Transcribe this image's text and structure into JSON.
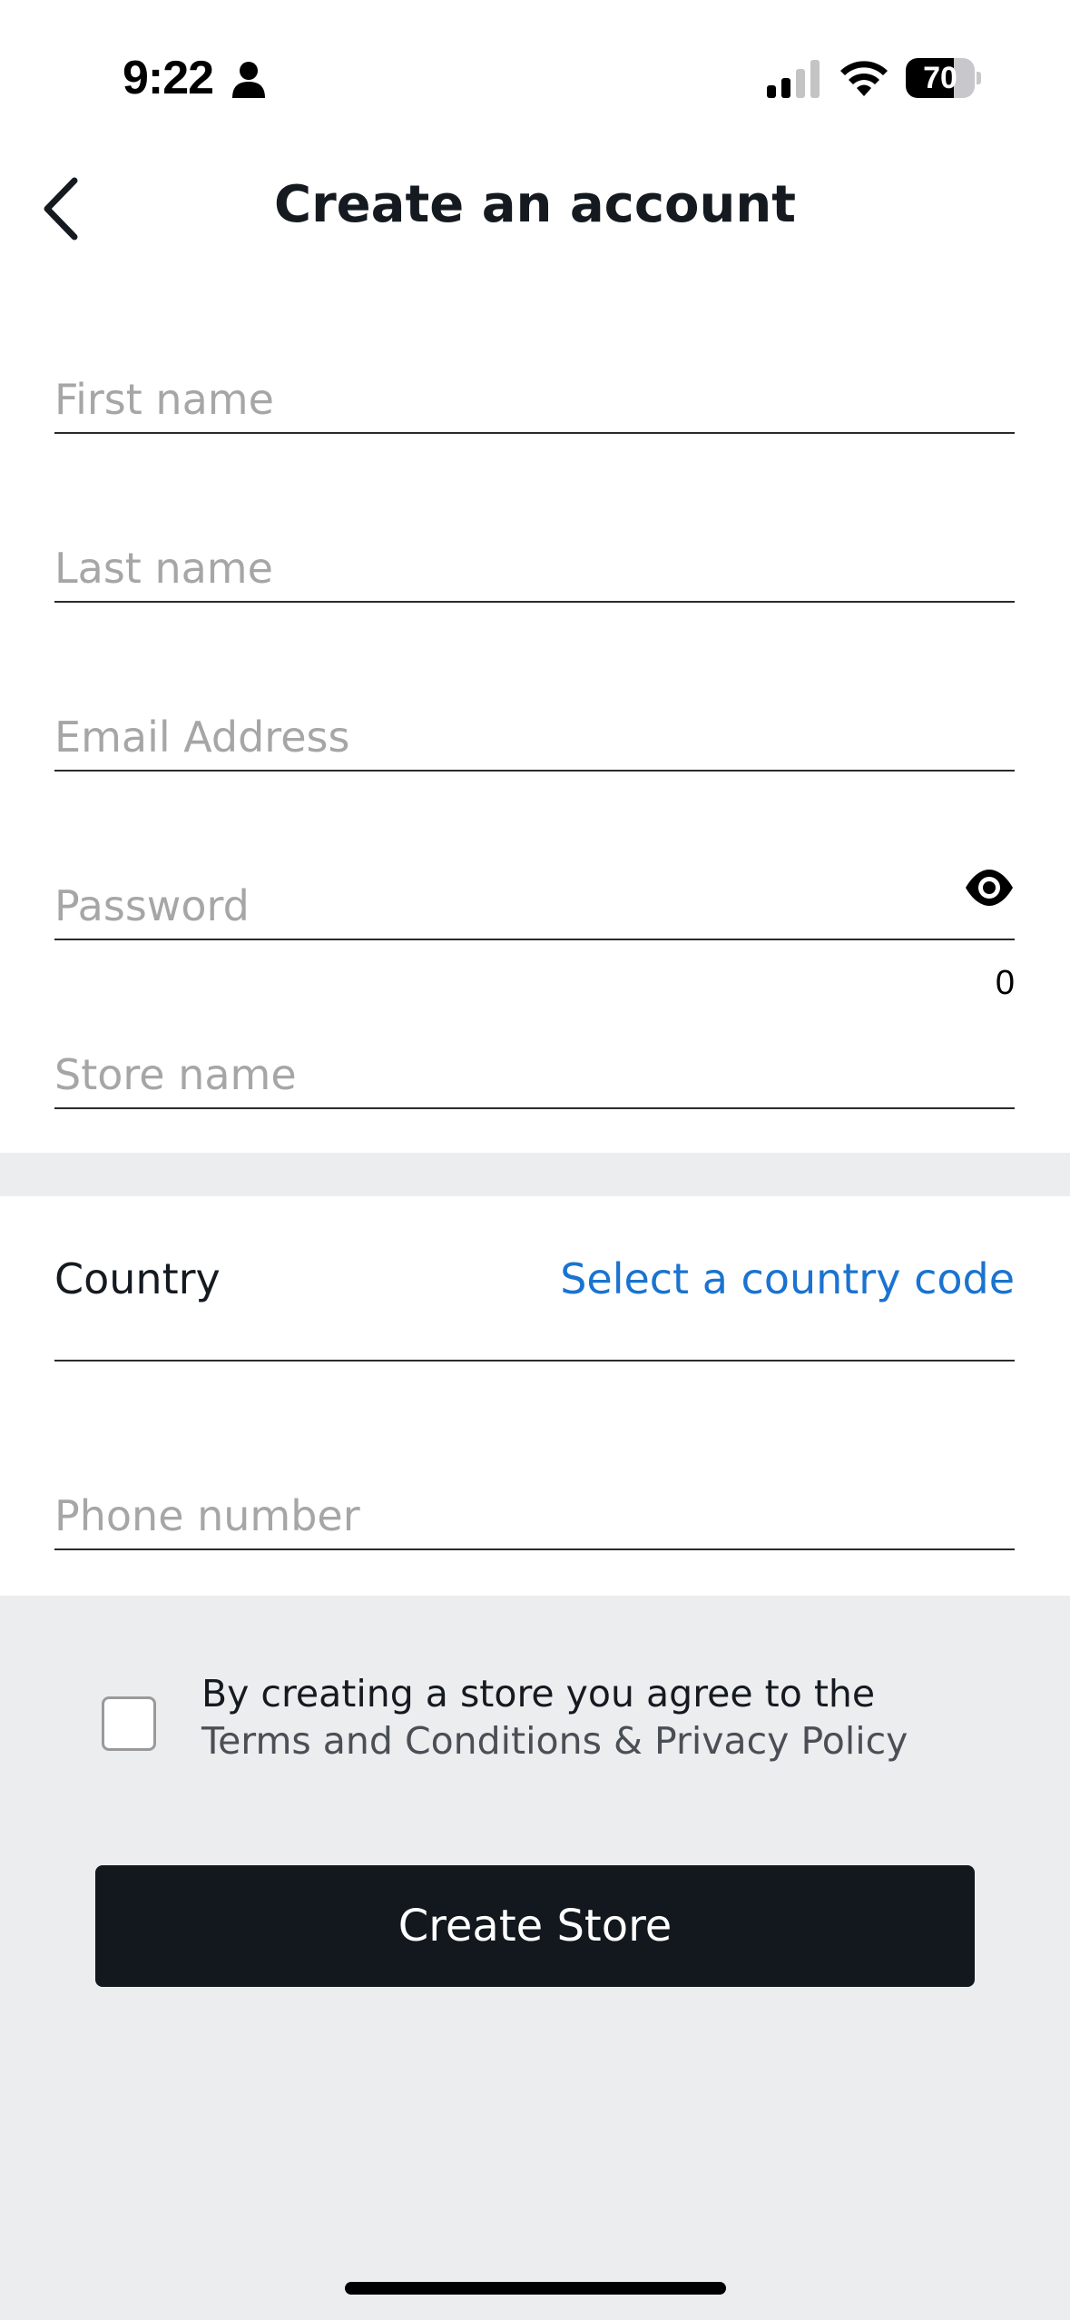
{
  "status_bar": {
    "time": "9:22",
    "battery_level": "70",
    "battery_fraction": 0.7,
    "icons": [
      "person-icon",
      "signal-icon",
      "wifi-icon",
      "battery-icon"
    ]
  },
  "header": {
    "title": "Create an account",
    "back_icon": "chevron-left-icon"
  },
  "form": {
    "first_name": {
      "placeholder": "First name",
      "value": ""
    },
    "last_name": {
      "placeholder": "Last name",
      "value": ""
    },
    "email": {
      "placeholder": "Email Address",
      "value": ""
    },
    "password": {
      "placeholder": "Password",
      "value": "",
      "char_count": "0",
      "toggle_icon": "eye-icon"
    },
    "store_name": {
      "placeholder": "Store name",
      "value": ""
    },
    "country": {
      "label": "Country",
      "select_text": "Select a country code"
    },
    "phone": {
      "placeholder": "Phone number",
      "value": ""
    }
  },
  "terms": {
    "prefix": "By creating a store you agree to the",
    "terms_link": "Terms and Conditions",
    "ampersand": " & ",
    "privacy_link": "Privacy Policy"
  },
  "actions": {
    "create_label": "Create Store"
  },
  "colors": {
    "accent_link": "#1a73d0",
    "button_bg": "#12181e",
    "page_bg": "#ecedef"
  }
}
